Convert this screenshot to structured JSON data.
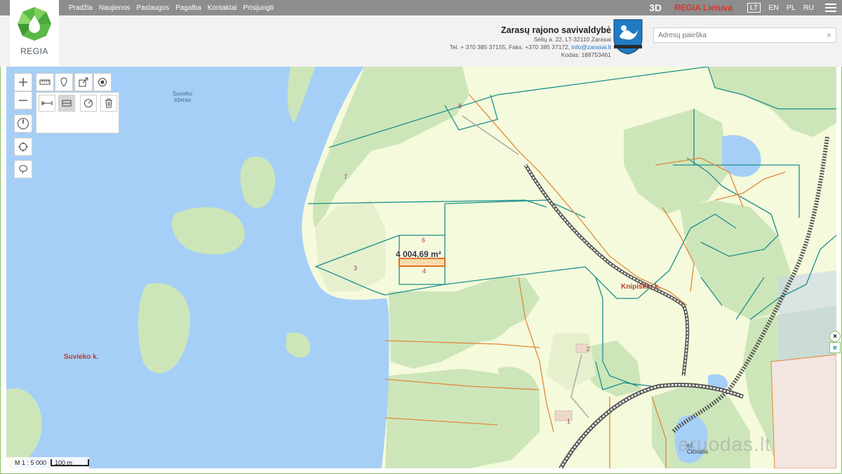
{
  "nav": [
    "Pradžia",
    "Naujienos",
    "Paslaugos",
    "Pagalba",
    "Kontaktai",
    "Prisijungti"
  ],
  "topbar": {
    "btn_3d": "3D",
    "brand": "REGIA Lietuva",
    "languages": [
      "LT",
      "EN",
      "PL",
      "RU"
    ],
    "active_language": "LT"
  },
  "logo": {
    "text": "REGIA"
  },
  "municipality": {
    "name": "Zarasų rajono savivaldybė",
    "address": "Sėlių a. 22, LT-32110 Zarasai",
    "phones": "Tel. + 370 385 37155, Faks. +370 385 37172,",
    "email": "info@zarasai.lt",
    "code": "Kodas: 188753461"
  },
  "search": {
    "placeholder": "Adresų paieška",
    "clear": "×"
  },
  "map": {
    "labels": {
      "lake": "Suvieko\nežeras",
      "village_west": "Suvieko k.",
      "village_east": "Knipiškių k.",
      "small_lake": "ež. Čičiraitis",
      "measure": "4 004,69 m²"
    },
    "parcels": [
      "8",
      "7",
      "6",
      "4",
      "3",
      "2",
      "1"
    ]
  },
  "scale": {
    "ratio": "M 1 : 5 000",
    "bar": "100 m"
  },
  "side_buttons": {
    "close": "×",
    "e": "e"
  },
  "watermark": "aruodas.lt",
  "colors": {
    "water": "#a6cff7",
    "forest": "#cde6b9",
    "field": "#f4fadb",
    "parcel_line": "#1c8f8e",
    "orange": "#e0883a",
    "road": "#555555",
    "accent_green": "#8bbf62",
    "brand_red": "#d9342b"
  }
}
